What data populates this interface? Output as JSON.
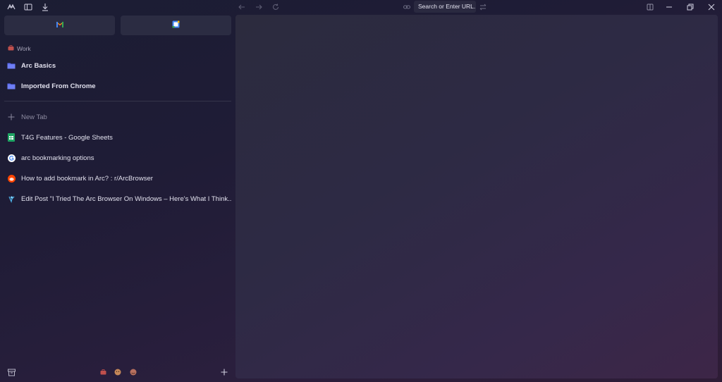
{
  "topbar": {
    "url_placeholder": "Search or Enter URL..."
  },
  "sidebar": {
    "favorites": [
      {
        "icon": "gmail-icon"
      },
      {
        "icon": "google-calendar-icon"
      }
    ],
    "space_label": "Work",
    "pinned": [
      {
        "label": "Arc Basics",
        "icon": "folder-icon"
      },
      {
        "label": "Imported From Chrome",
        "icon": "folder-icon"
      }
    ],
    "new_tab_label": "New Tab",
    "tabs": [
      {
        "label": "T4G Features - Google Sheets",
        "icon": "google-sheets-icon"
      },
      {
        "label": "arc bookmarking options",
        "icon": "google-icon"
      },
      {
        "label": "How to add bookmark in Arc? : r/ArcBrowser",
        "icon": "reddit-icon"
      },
      {
        "label": "Edit Post \"I Tried The Arc Browser On Windows – Here's What I Think...",
        "icon": "wordpress-icon"
      }
    ]
  },
  "colors": {
    "folder": "#5b6cf0",
    "sheets": "#1fa463",
    "reddit": "#ff4500"
  }
}
